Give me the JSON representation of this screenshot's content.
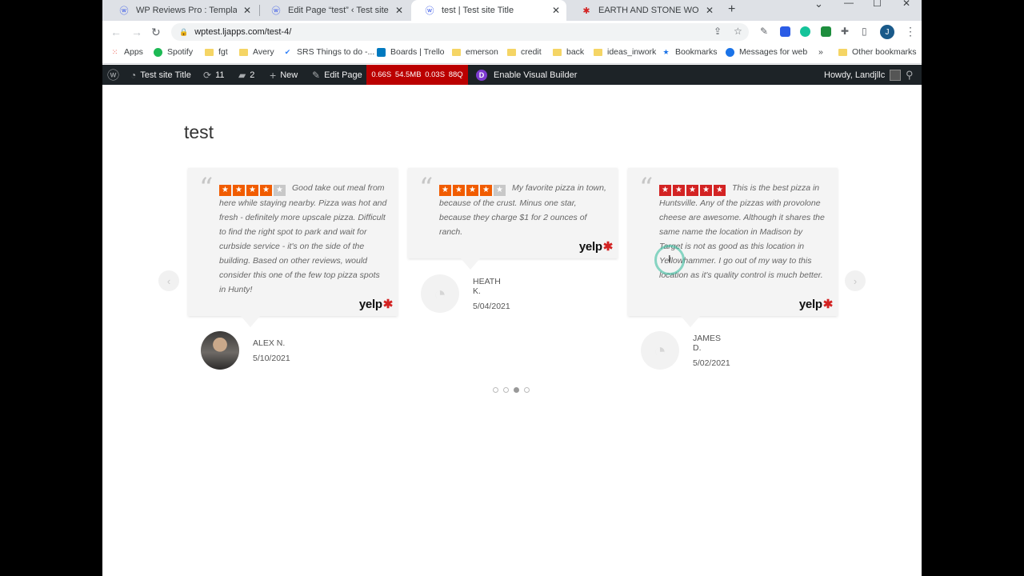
{
  "browser": {
    "tabs": [
      {
        "title": "WP Reviews Pro : Templates ‹ Tes",
        "favicon": "wordpress-icon",
        "active": false
      },
      {
        "title": "Edit Page “test” ‹ Test site Title —",
        "favicon": "wordpress-icon",
        "active": false
      },
      {
        "title": "test | Test site Title",
        "favicon": "wordpress-icon",
        "active": true
      },
      {
        "title": "EARTH AND STONE WOOD FIRE",
        "favicon": "yelp-icon",
        "active": false
      }
    ],
    "url": "wptest.ljapps.com/test-4/",
    "profile_initial": "J",
    "bookmarks": [
      {
        "label": "Apps",
        "icon": "apps-grid-icon"
      },
      {
        "label": "Spotify",
        "icon": "spotify-icon"
      },
      {
        "label": "fgt",
        "icon": "folder-icon"
      },
      {
        "label": "Avery",
        "icon": "folder-icon"
      },
      {
        "label": "SRS Things to do -...",
        "icon": "checkmark-icon"
      },
      {
        "label": "Boards | Trello",
        "icon": "trello-icon"
      },
      {
        "label": "emerson",
        "icon": "folder-icon"
      },
      {
        "label": "credit",
        "icon": "folder-icon"
      },
      {
        "label": "back",
        "icon": "folder-icon"
      },
      {
        "label": "ideas_inwork",
        "icon": "folder-icon"
      },
      {
        "label": "Bookmarks",
        "icon": "star-icon"
      },
      {
        "label": "Messages for web",
        "icon": "messages-icon"
      }
    ],
    "more_bookmarks": "»",
    "other_bookmarks": "Other bookmarks"
  },
  "adminbar": {
    "site_title": "Test site Title",
    "updates_count": "11",
    "comments_count": "2",
    "new_label": "New",
    "edit_label": "Edit Page",
    "query_monitor": [
      "0.66S",
      "54.5MB",
      "0.03S",
      "88Q"
    ],
    "visual_builder": "Enable Visual Builder",
    "greeting": "Howdy, Landjllc"
  },
  "page": {
    "title": "test",
    "prev_arrow": "‹",
    "next_arrow": "›"
  },
  "reviews": [
    {
      "rating": 4,
      "text": "Good take out meal from here while staying nearby. Pizza was hot and fresh - definitely more upscale pizza. Difficult to find the right spot to park and wait for curbside service - it's on the side of the building. Based on other reviews, would consider this one of the few top pizza spots in Hunty!",
      "source": "yelp",
      "author": "ALEX N.",
      "date": "5/10/2021",
      "avatar": "photo"
    },
    {
      "rating": 4,
      "text": "My favorite pizza in town, because of the crust. Minus one star, because they charge $1 for 2 ounces of ranch.",
      "source": "yelp",
      "author": "HEATH K.",
      "date": "5/04/2021",
      "avatar": "blank"
    },
    {
      "rating": 5,
      "text": "This is the best pizza in Huntsville. Any of the pizzas with provolone cheese are awesome. Although it shares the same name the location in Madison by Target is not as good as this location in Yellowhammer. I go out of my way to this location as it's quality control is much better.",
      "source": "yelp",
      "author": "JAMES D.",
      "date": "5/02/2021",
      "avatar": "blank"
    }
  ],
  "pagination": {
    "count": 4,
    "active": 2
  },
  "colors": {
    "star_4": "#f15c00",
    "star_5": "#d32323",
    "star_empty": "#c8c8c8",
    "yelp_red": "#d32323",
    "adminbar_bg": "#1d2327",
    "query_monitor_bg": "#bb0000"
  }
}
